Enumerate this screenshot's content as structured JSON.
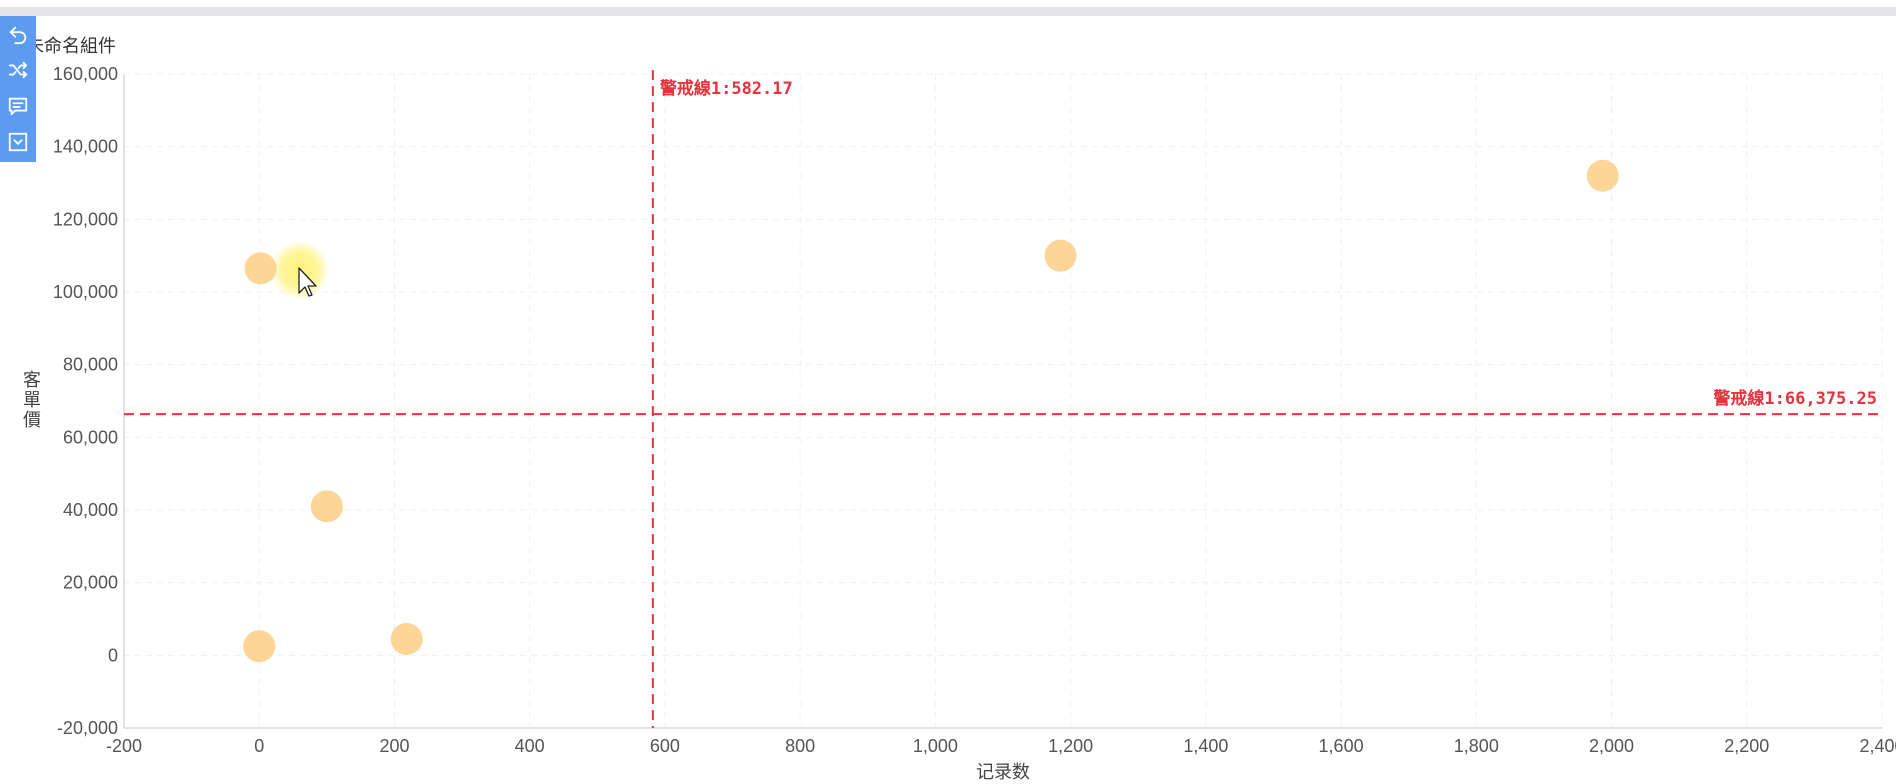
{
  "widget": {
    "title": "未命名組件"
  },
  "toolbar": {
    "icons": [
      "undo-icon",
      "shuffle-icon",
      "comment-icon",
      "collapse-icon"
    ]
  },
  "colors": {
    "accent": "#5b9bf0",
    "point": "#fdd08c",
    "warning": "#e8323c",
    "highlight": "#fff27a"
  },
  "chart_data": {
    "type": "scatter",
    "title": "",
    "xlabel": "记录数",
    "ylabel": "客單價",
    "xlim": [
      -200,
      2400
    ],
    "ylim": [
      -20000,
      160000
    ],
    "xticks": [
      -200,
      0,
      200,
      400,
      600,
      800,
      1000,
      1200,
      1400,
      1600,
      1800,
      2000,
      2200,
      2400
    ],
    "xtick_labels": [
      "-200",
      "0",
      "200",
      "400",
      "600",
      "800",
      "1,000",
      "1,200",
      "1,400",
      "1,600",
      "1,800",
      "2,000",
      "2,200",
      "2,400"
    ],
    "yticks": [
      -20000,
      0,
      20000,
      40000,
      60000,
      80000,
      100000,
      120000,
      140000,
      160000
    ],
    "ytick_labels": [
      "-20,000",
      "0",
      "20,000",
      "40,000",
      "60,000",
      "80,000",
      "100,000",
      "120,000",
      "140,000",
      "160,000"
    ],
    "grid": true,
    "points": [
      {
        "x": 2,
        "y": 106500
      },
      {
        "x": 100,
        "y": 41000
      },
      {
        "x": 0,
        "y": 2500
      },
      {
        "x": 218,
        "y": 4500
      },
      {
        "x": 1185,
        "y": 110000
      },
      {
        "x": 1987,
        "y": 132000
      }
    ],
    "highlight_point": {
      "x": 60,
      "y": 106000
    },
    "warning_lines": [
      {
        "axis": "x",
        "value": 582.17,
        "label": "警戒線1:582.17"
      },
      {
        "axis": "y",
        "value": 66375.25,
        "label": "警戒線1:66,375.25"
      }
    ]
  }
}
